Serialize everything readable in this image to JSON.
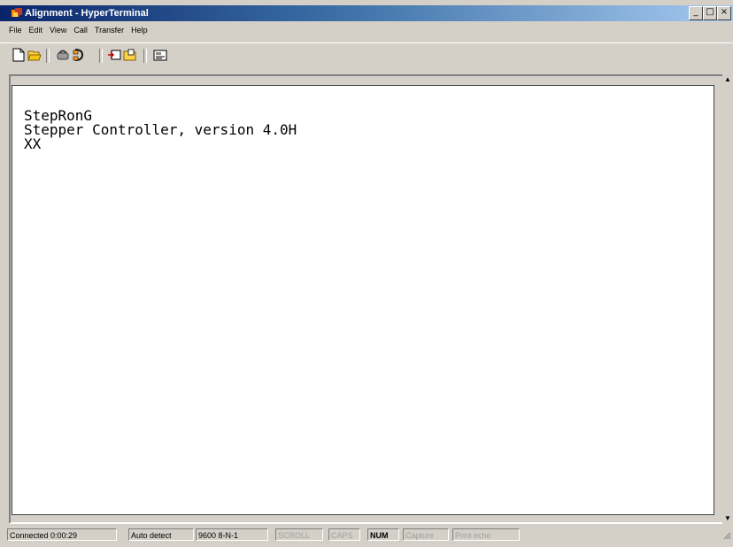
{
  "window": {
    "title": "Alignment - HyperTerminal"
  },
  "titlebar_buttons": [
    "_",
    "□",
    "×"
  ],
  "menu": [
    "File",
    "Edit",
    "View",
    "Call",
    "Transfer",
    "Help"
  ],
  "toolbar": {
    "icons": [
      "new-icon",
      "open-icon",
      "disconnect-icon",
      "connect-icon",
      "send-icon",
      "receive-icon",
      "properties-icon"
    ]
  },
  "terminal": {
    "lines": [
      "StepRonG",
      "Stepper Controller, version 4.0H",
      "XX"
    ]
  },
  "statusbar": {
    "connected": "Connected 0:00:29",
    "detect": "Auto detect",
    "settings": "9600 8-N-1",
    "scroll": "SCROLL",
    "caps": "CAPS",
    "num": "NUM",
    "capture": "Capture",
    "print_echo": "Print echo"
  }
}
